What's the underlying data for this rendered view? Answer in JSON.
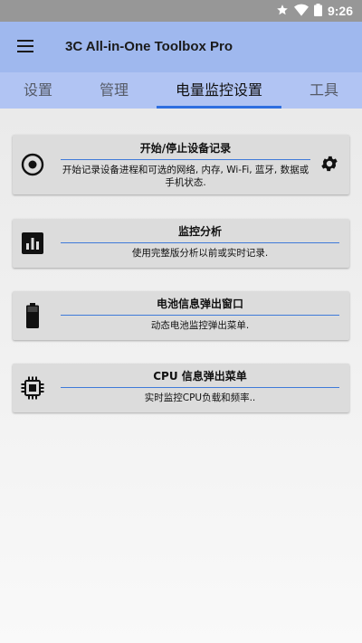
{
  "status_bar": {
    "time": "9:26"
  },
  "app_bar": {
    "title": "3C All-in-One Toolbox Pro"
  },
  "tabs": [
    {
      "label": "设置"
    },
    {
      "label": "管理"
    },
    {
      "label": "电量监控设置",
      "active": true
    },
    {
      "label": "工具"
    }
  ],
  "cards": [
    {
      "icon": "record-icon",
      "title": "开始/停止设备记录",
      "description": "开始记录设备进程和可选的网络, 内存, Wi-Fi, 蓝牙, 数据或手机状态.",
      "action_icon": "gear-icon"
    },
    {
      "icon": "bar-chart-icon",
      "title": "监控分析",
      "description": "使用完整版分析以前或实时记录."
    },
    {
      "icon": "battery-icon",
      "title": "电池信息弹出窗口",
      "description": "动态电池监控弹出菜单."
    },
    {
      "icon": "cpu-chip-icon",
      "title": "CPU 信息弹出菜单",
      "description": "实时监控CPU负载和频率.."
    }
  ],
  "colors": {
    "app_bar": "#9fb8ee",
    "tab_bar": "#b1c4f3",
    "tab_indicator": "#2f6fe0",
    "card": "#dcdcdc",
    "card_divider": "#3f7ad9"
  }
}
